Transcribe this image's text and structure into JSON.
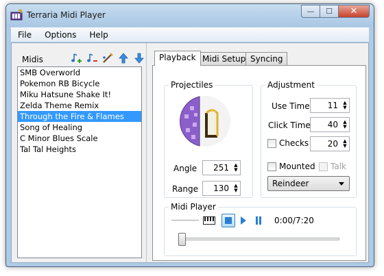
{
  "window": {
    "title": "Terraria Midi Player",
    "close_glyph": "✕",
    "minimize_glyph": "—",
    "maximize_glyph": "☐"
  },
  "menu": [
    "File",
    "Options",
    "Help"
  ],
  "midis": {
    "label": "Midis",
    "tools": [
      "add-note-icon",
      "remove-note-icon",
      "edit-note-icon",
      "move-up-icon",
      "move-down-icon"
    ],
    "items": [
      "SMB Overworld",
      "Pokemon RB Bicycle",
      "Miku Hatsune Shake It!",
      "Zelda Theme Remix",
      "Through the Fire & Flames",
      "Song of Healing",
      "C Minor Blues Scale",
      "Tal Tal Heights"
    ],
    "selected_index": 4
  },
  "tabs": [
    "Playback",
    "Midi Setup",
    "Syncing"
  ],
  "active_tab": "Playback",
  "projectiles": {
    "title": "Projectiles",
    "angle_label": "Angle",
    "angle_value": "251",
    "range_label": "Range",
    "range_value": "130"
  },
  "adjustment": {
    "title": "Adjustment",
    "use_time_label": "Use Time",
    "use_time_value": "11",
    "click_time_label": "Click Time",
    "click_time_value": "40",
    "checks_label": "Checks",
    "checks_value": "20",
    "mounted_label": "Mounted",
    "talk_label": "Talk",
    "mount_selected": "Reindeer"
  },
  "player": {
    "title": "Midi Player",
    "time": "0:00/7:20",
    "progress": 0
  },
  "colors": {
    "selection": "#3399ff",
    "accent_blue": "#2a7fd4"
  }
}
